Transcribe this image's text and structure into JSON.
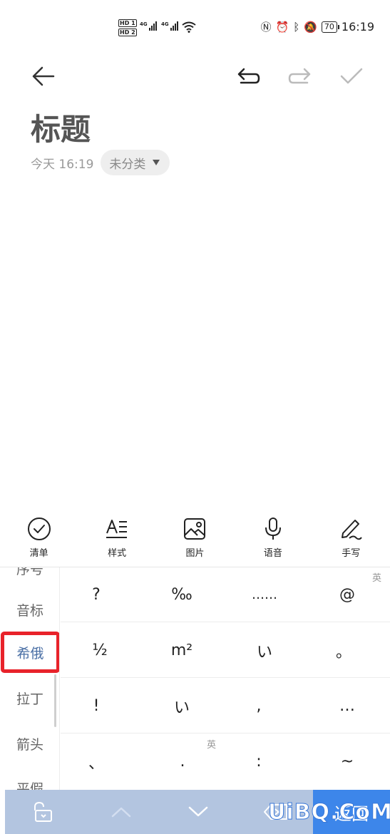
{
  "status_bar": {
    "sim_labels": [
      "HD 1",
      "HD 2"
    ],
    "network_labels": [
      "4G",
      "4G"
    ],
    "icons": [
      "nfc-icon",
      "alarm-icon",
      "bluetooth-icon",
      "mute-icon"
    ],
    "battery": "70",
    "time": "16:19"
  },
  "toolbar": {
    "icons": [
      "back-arrow-icon",
      "undo-icon",
      "redo-icon",
      "check-icon"
    ]
  },
  "note": {
    "title": "标题",
    "time": "今天 16:19",
    "category": "未分类"
  },
  "format_bar": {
    "items": [
      {
        "label": "清单",
        "icon": "checklist-icon"
      },
      {
        "label": "样式",
        "icon": "text-style-icon"
      },
      {
        "label": "图片",
        "icon": "image-icon"
      },
      {
        "label": "语音",
        "icon": "microphone-icon"
      },
      {
        "label": "手写",
        "icon": "handwriting-icon"
      }
    ]
  },
  "keyboard": {
    "categories": [
      "序号",
      "音标",
      "希俄",
      "拉丁",
      "箭头",
      "平假"
    ],
    "selected_category": "希俄",
    "rows": [
      [
        "?",
        "‰",
        "……",
        "@"
      ],
      [
        "½",
        "m²",
        "い",
        "。"
      ],
      [
        "!",
        "い",
        ",",
        "…"
      ],
      [
        "、",
        ".",
        ":",
        "~"
      ]
    ],
    "en_marks": [
      "英",
      "英"
    ],
    "colors": {
      "selected_border": "#e8222a",
      "return_button": "#3d86ea",
      "bottom_bar": "#b3c5e0"
    }
  },
  "bottom_bar": {
    "icons": [
      "lock-icon",
      "chevron-up-icon",
      "chevron-down-icon",
      "backspace-icon"
    ],
    "return_label": "返回"
  },
  "watermark": "UiBQ.CoM"
}
